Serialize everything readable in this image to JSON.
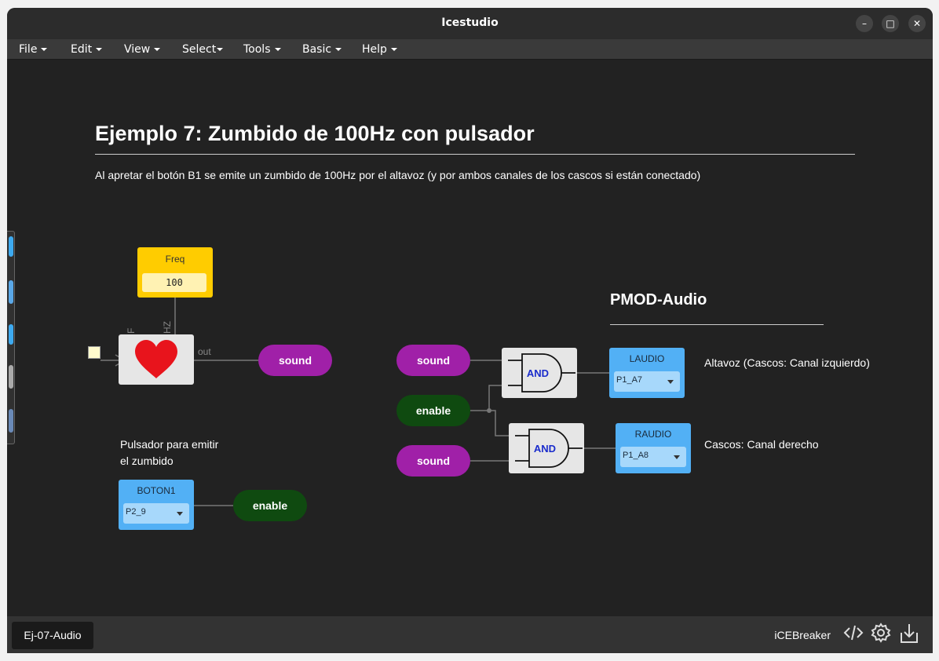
{
  "window": {
    "title": "Icestudio",
    "controls": {
      "minimize": "–",
      "maximize": "□",
      "close": "✕"
    }
  },
  "menu": [
    {
      "label": "File"
    },
    {
      "label": "Edit"
    },
    {
      "label": "View"
    },
    {
      "label": "Select"
    },
    {
      "label": "Tools"
    },
    {
      "label": "Basic"
    },
    {
      "label": "Help"
    }
  ],
  "canvas": {
    "heading": "Ejemplo 7: Zumbido de 100Hz con pulsador",
    "description": "Al apretar el botón B1 se emite un zumbido de 100Hz por el altavoz (y por ambos canales de los cascos si están conectado)",
    "pmod_heading": "PMOD-Audio",
    "note_button": [
      "Pulsador para emitir",
      "el zumbido"
    ],
    "note_left": "Altavoz (Cascos: Canal izquierdo)",
    "note_right": "Cascos: Canal derecho",
    "freq_block": {
      "label": "Freq",
      "value": "100"
    },
    "heart_block": {
      "port_in_label": "F",
      "port_hz_label": "HZ",
      "port_out_label": "out",
      "icon": "heart-icon"
    },
    "labels": {
      "sound_out": "sound",
      "sound_in_1": "sound",
      "enable_in": "enable",
      "sound_in_2": "sound",
      "enable_out": "enable"
    },
    "and_gates": [
      {
        "label": "AND"
      },
      {
        "label": "AND"
      }
    ],
    "pins": {
      "laudio": {
        "label": "LAUDIO",
        "value": "P1_A7"
      },
      "raudio": {
        "label": "RAUDIO",
        "value": "P1_A8"
      },
      "boton1": {
        "label": "BOTON1",
        "value": "P2_9"
      }
    },
    "colors": {
      "freq": "#ffcc00",
      "pin": "#52b0f5",
      "sound": "#a020a8",
      "enable": "#0f4a10",
      "heart": "#e8141c",
      "and_text": "#1a2ccc"
    }
  },
  "statusbar": {
    "tab": "Ej-07-Audio",
    "board": "iCEBreaker",
    "icons": [
      "code-icon",
      "gear-icon",
      "download-icon"
    ]
  }
}
